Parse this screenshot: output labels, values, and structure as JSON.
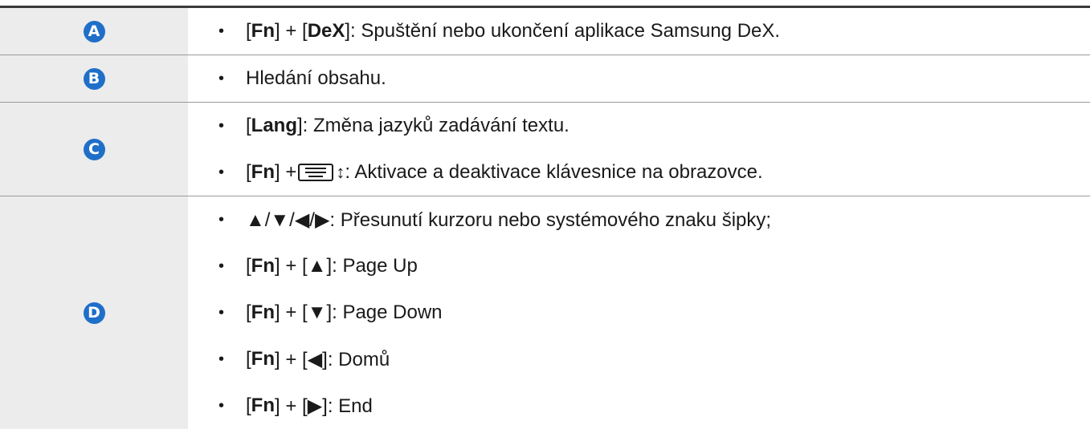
{
  "rows": [
    {
      "badge": "A",
      "lines": [
        {
          "bullet": "•",
          "pre": "[",
          "key1": "Fn",
          "mid": "] + [",
          "key2": "DeX",
          "post": "]: Spuštění nebo ukončení aplikace Samsung DeX."
        }
      ]
    },
    {
      "badge": "B",
      "lines": [
        {
          "bullet": "•",
          "text": "Hledání obsahu."
        }
      ]
    },
    {
      "badge": "C",
      "lines": [
        {
          "bullet": "•",
          "pre": "[",
          "key1": "Lang",
          "post": "]: Změna jazyků zadávání textu."
        },
        {
          "bullet": "•",
          "pre": "[",
          "key1": "Fn",
          "mid": "] + ",
          "icon": "keyboard-toggle-icon",
          "arrows": "↕",
          "post": ": Aktivace a deaktivace klávesnice na obrazovce."
        }
      ]
    },
    {
      "badge": "D",
      "lines": [
        {
          "bullet": "•",
          "text": "▲/▼/◀/▶: Přesunutí kurzoru nebo systémového znaku šipky;"
        },
        {
          "bullet": "•",
          "pre": "[",
          "key1": "Fn",
          "post": "] + [▲]: Page Up"
        },
        {
          "bullet": "•",
          "pre": "[",
          "key1": "Fn",
          "post": "] + [▼]: Page Down"
        },
        {
          "bullet": "•",
          "pre": "[",
          "key1": "Fn",
          "post": "] + [◀]: Domů"
        },
        {
          "bullet": "•",
          "pre": "[",
          "key1": "Fn",
          "post": "] + [▶]: End"
        }
      ]
    }
  ]
}
